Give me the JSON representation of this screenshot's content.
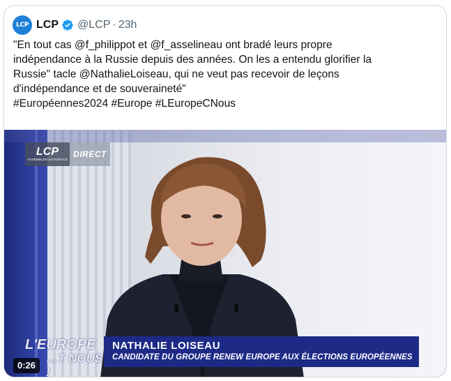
{
  "tweet": {
    "author": {
      "avatar_text": "LCP",
      "display_name": "LCP",
      "handle": "@LCP",
      "separator": "·",
      "time": "23h",
      "verified_icon": "verified-badge-icon"
    },
    "text_lines": [
      "\"En tout cas @f_philippot et @f_asselineau ont bradé leurs propre",
      "indépendance à la Russie depuis des années. On les a entendu glorifier la",
      "Russie\" tacle @NathalieLoiseau, qui ne veut pas recevoir de leçons",
      "d'indépendance et de souveraineté\"",
      "#Européennes2024 #Europe #LEuropeCNous"
    ]
  },
  "video": {
    "live_logo": "LCP",
    "live_logo_sub": "ASSEMBLÉE NATIONALE",
    "live_label": "DIRECT",
    "brand_line1": "L'EUROPE",
    "brand_line2": "…T NOUS !",
    "lower_third_name": "NATHALIE LOISEAU",
    "lower_third_role": "CANDIDATE DU GROUPE RENEW EUROPE AUX ÉLECTIONS EUROPÉENNES",
    "duration": "0:26"
  },
  "colors": {
    "text_primary": "#0f1419",
    "text_secondary": "#536471",
    "verified": "#1d9bf0",
    "lower_third_bg": "#1d2a86",
    "avatar_bg": "#1e7fd6"
  }
}
